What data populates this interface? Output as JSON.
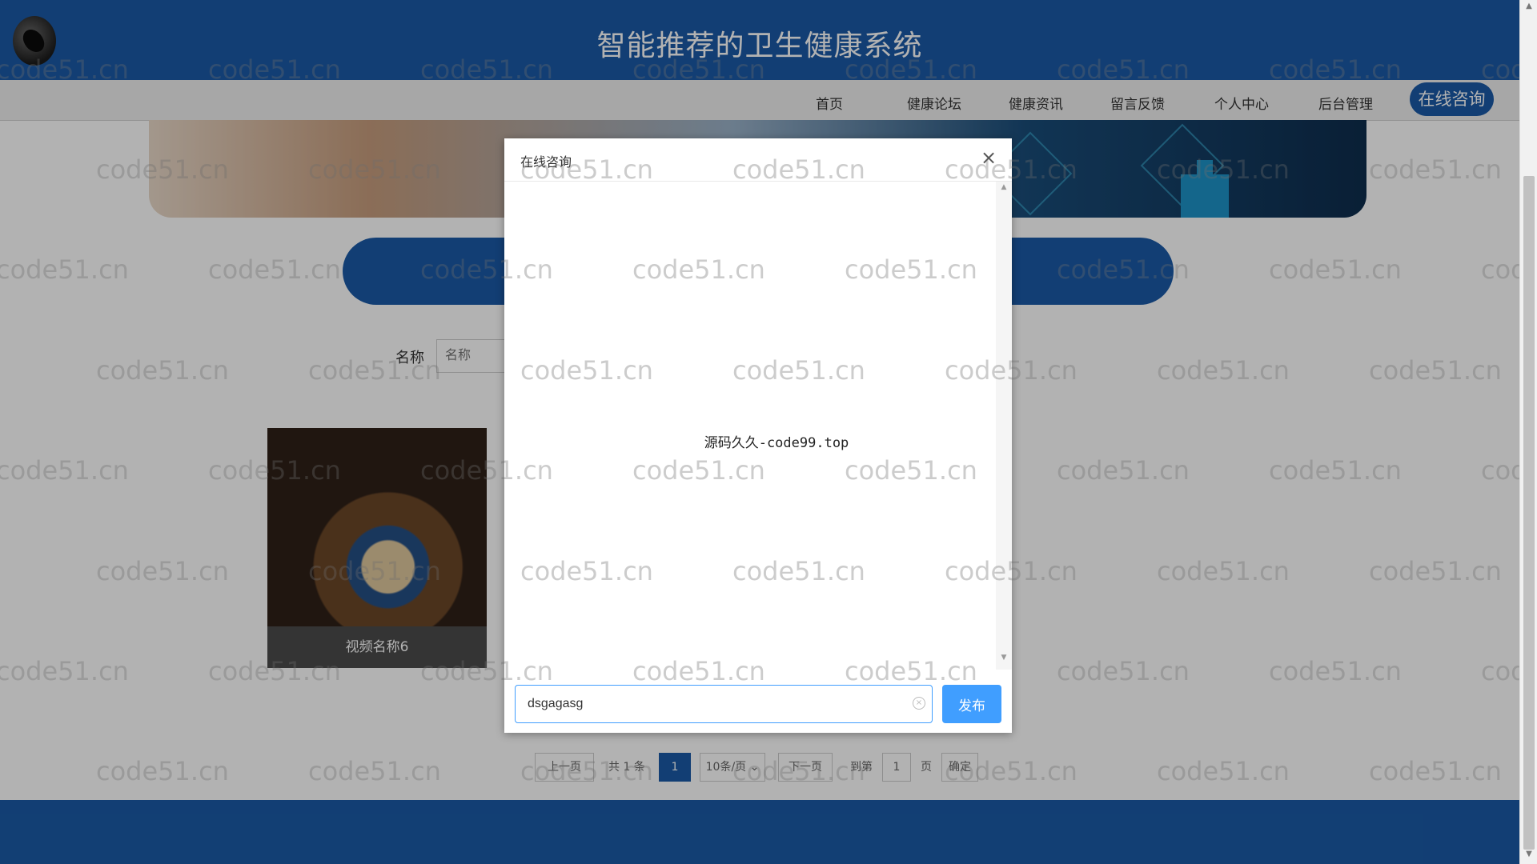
{
  "header": {
    "title": "智能推荐的卫生健康系统"
  },
  "nav": {
    "items": [
      "首页",
      "健康论坛",
      "健康资讯",
      "留言反馈",
      "个人中心",
      "后台管理"
    ],
    "active": "在线咨询"
  },
  "search": {
    "label": "名称",
    "placeholder": "名称"
  },
  "cards": [
    {
      "title": "视频名称6"
    }
  ],
  "pager": {
    "prev": "上一页",
    "total": "共 1 条",
    "current": "1",
    "page_size": "10条/页",
    "next": "下一页",
    "goto_label": "到第",
    "goto_value": "1",
    "page_unit": "页",
    "confirm": "确定"
  },
  "modal": {
    "title": "在线咨询",
    "close": "×",
    "message": "源码久久-code99.top",
    "input_value": "dsgagasg",
    "send_label": "发布"
  },
  "watermark": "code51.cn",
  "colors": {
    "primary": "#1a5aa6",
    "button": "#409eff"
  }
}
